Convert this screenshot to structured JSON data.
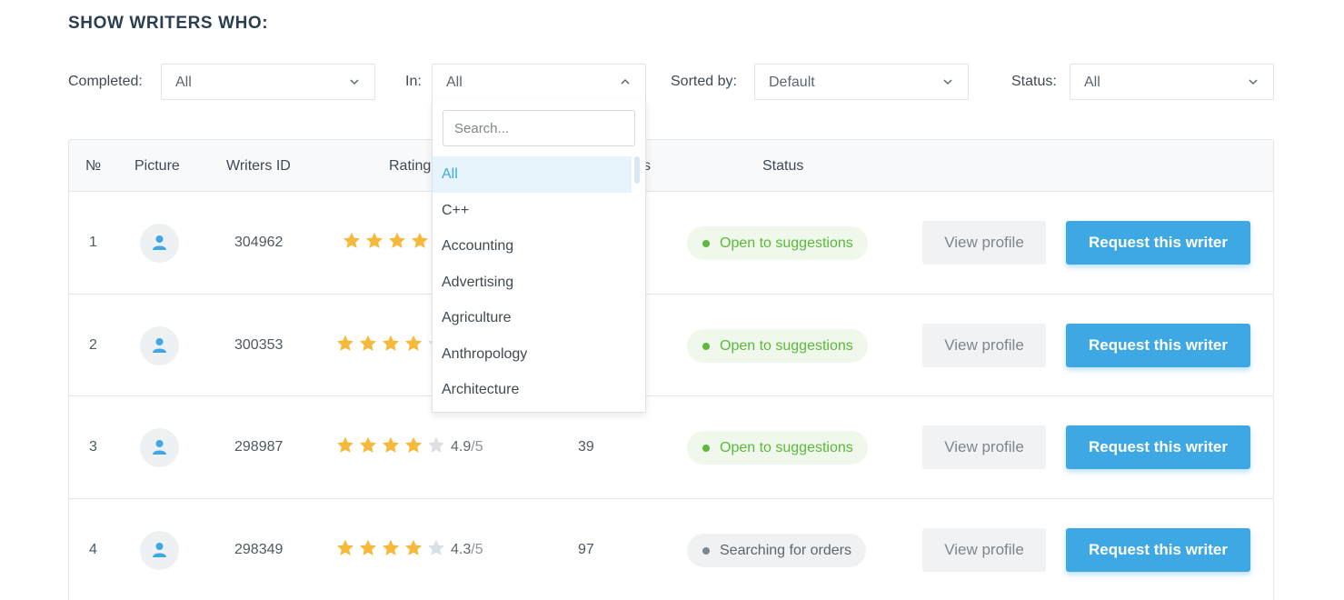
{
  "heading": "SHOW WRITERS WHO:",
  "filters": {
    "completed": {
      "label": "Completed:",
      "value": "All"
    },
    "in": {
      "label": "In:",
      "value": "All"
    },
    "sorted": {
      "label": "Sorted by:",
      "value": "Default"
    },
    "status": {
      "label": "Status:",
      "value": "All"
    }
  },
  "dropdown": {
    "search_placeholder": "Search...",
    "options": [
      "All",
      "C++",
      "Accounting",
      "Advertising",
      "Agriculture",
      "Anthropology",
      "Architecture"
    ],
    "selected": "All"
  },
  "table": {
    "headers": {
      "num": "№",
      "picture": "Picture",
      "writer_id": "Writers ID",
      "rating": "Rating",
      "orders": "s",
      "status": "Status"
    },
    "rows": [
      {
        "num": "1",
        "writer_id": "304962",
        "stars": 4,
        "rating": "",
        "rating_den": "",
        "orders": "",
        "status": "Open to suggestions",
        "status_type": "green"
      },
      {
        "num": "2",
        "writer_id": "300353",
        "stars": 4,
        "rating": "",
        "rating_den": "",
        "orders": "",
        "status": "Open to suggestions",
        "status_type": "green"
      },
      {
        "num": "3",
        "writer_id": "298987",
        "stars": 4,
        "rating": "4.9",
        "rating_den": "/5",
        "orders": "39",
        "status": "Open to suggestions",
        "status_type": "green"
      },
      {
        "num": "4",
        "writer_id": "298349",
        "stars": 4,
        "rating": "4.3",
        "rating_den": "/5",
        "orders": "97",
        "status": "Searching for orders",
        "status_type": "gray"
      }
    ],
    "view_label": "View profile",
    "request_label": "Request this writer"
  },
  "colors": {
    "accent": "#3ea8e5",
    "star": "#f6b93b",
    "star_empty": "#dcdfe2",
    "green": "#5cb83e"
  },
  "icons": {
    "chevron": "chevron-down-icon",
    "chevron_open": "chevron-up-icon",
    "avatar": "user-icon",
    "star": "star-icon"
  }
}
